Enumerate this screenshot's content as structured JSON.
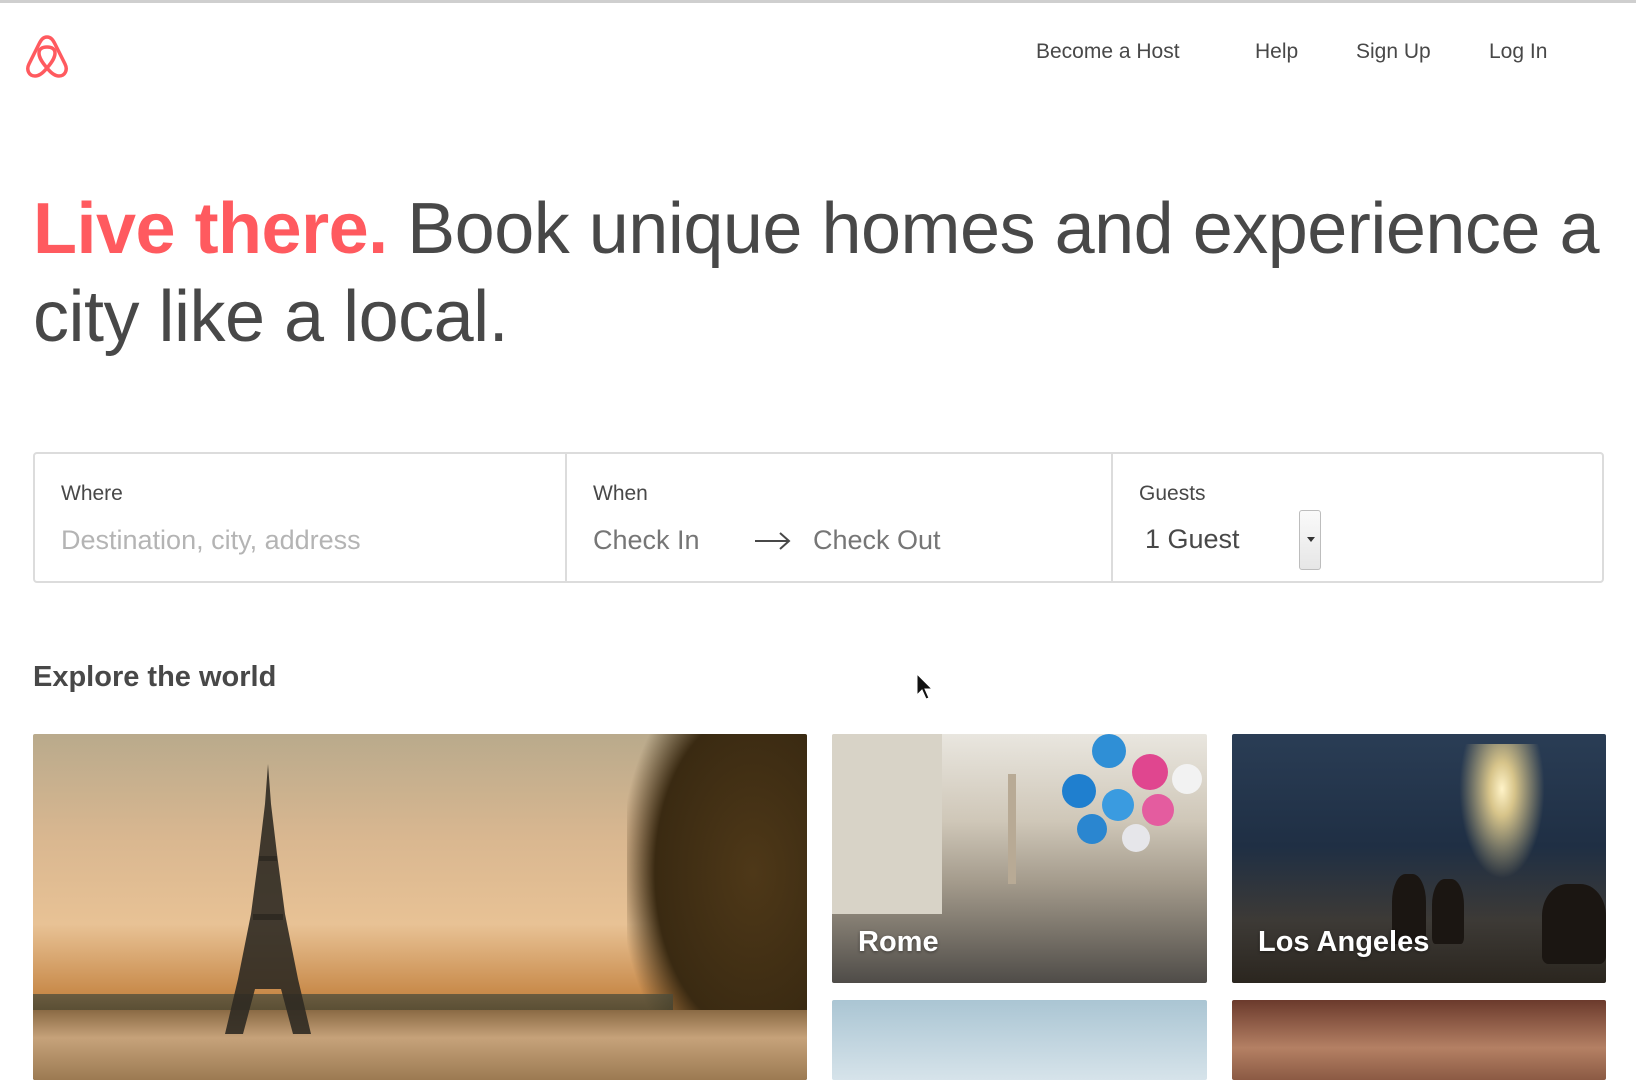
{
  "brand": {
    "logo_icon": "airbnb-belo-icon",
    "accent_color": "#ff5a5f"
  },
  "nav": {
    "become_host": "Become a Host",
    "help": "Help",
    "sign_up": "Sign Up",
    "log_in": "Log In"
  },
  "hero": {
    "accent": "Live there.",
    "rest": " Book unique homes and experience a city like a local."
  },
  "search": {
    "where_label": "Where",
    "where_placeholder": "Destination, city, address",
    "when_label": "When",
    "check_in": "Check In",
    "check_out": "Check Out",
    "arrow_icon": "right-arrow-icon",
    "guests_label": "Guests",
    "guests_value": "1 Guest",
    "search_icon": "search-icon"
  },
  "explore": {
    "title": "Explore the world",
    "cities": [
      {
        "label": ""
      },
      {
        "label": "Rome"
      },
      {
        "label": "Los Angeles"
      },
      {
        "label": ""
      },
      {
        "label": ""
      }
    ]
  }
}
